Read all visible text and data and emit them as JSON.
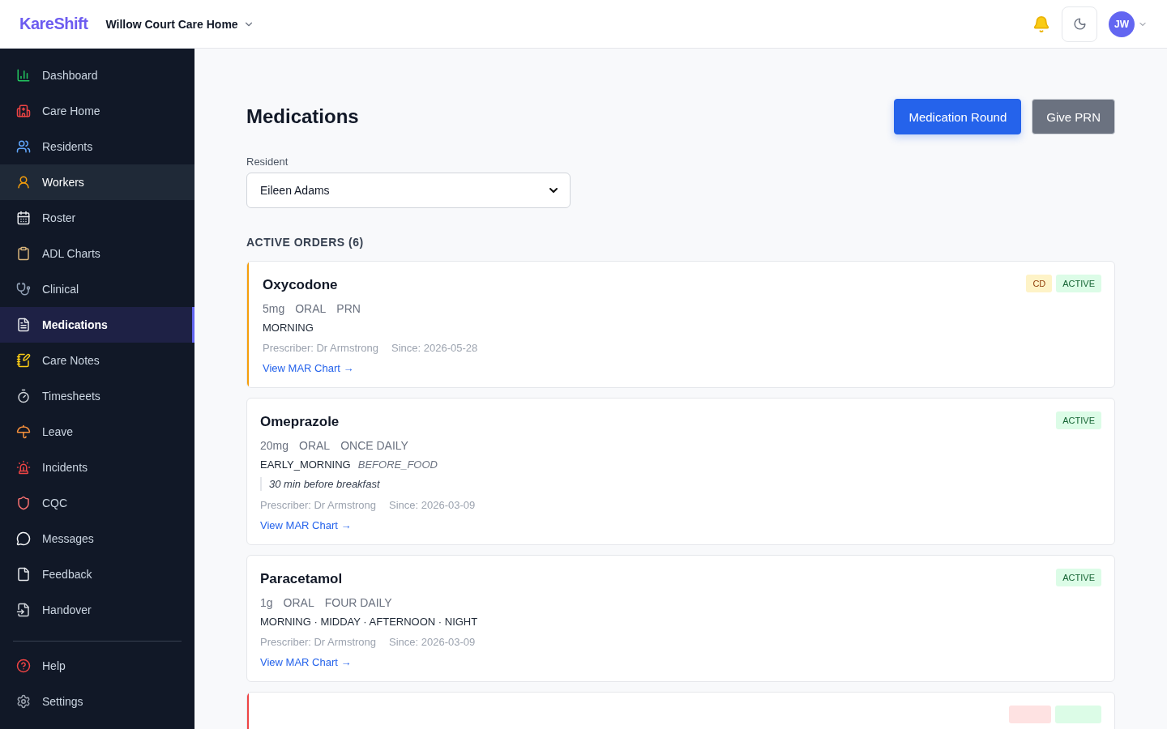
{
  "header": {
    "logo": "KareShift",
    "home": "Willow Court Care Home",
    "avatar": "JW"
  },
  "sidebar": {
    "items": [
      {
        "label": "Dashboard",
        "selected": false,
        "hovered": false
      },
      {
        "label": "Care Home",
        "selected": false,
        "hovered": false
      },
      {
        "label": "Residents",
        "selected": false,
        "hovered": false
      },
      {
        "label": "Workers",
        "selected": false,
        "hovered": true
      },
      {
        "label": "Roster",
        "selected": false,
        "hovered": false
      },
      {
        "label": "ADL Charts",
        "selected": false,
        "hovered": false
      },
      {
        "label": "Clinical",
        "selected": false,
        "hovered": false
      },
      {
        "label": "Medications",
        "selected": true,
        "hovered": false
      },
      {
        "label": "Care Notes",
        "selected": false,
        "hovered": false
      },
      {
        "label": "Timesheets",
        "selected": false,
        "hovered": false
      },
      {
        "label": "Leave",
        "selected": false,
        "hovered": false
      },
      {
        "label": "Incidents",
        "selected": false,
        "hovered": false
      },
      {
        "label": "CQC",
        "selected": false,
        "hovered": false
      },
      {
        "label": "Messages",
        "selected": false,
        "hovered": false
      },
      {
        "label": "Feedback",
        "selected": false,
        "hovered": false
      },
      {
        "label": "Handover",
        "selected": false,
        "hovered": false
      }
    ],
    "footer_items": [
      {
        "label": "Help"
      },
      {
        "label": "Settings"
      }
    ]
  },
  "page": {
    "title": "Medications",
    "buttons": [
      {
        "label": "Medication Round",
        "kind": "primary"
      },
      {
        "label": "Give PRN",
        "kind": "secondary"
      }
    ],
    "resident_label": "Resident",
    "resident_value": "Eileen Adams",
    "section_title": "ACTIVE ORDERS (6)"
  },
  "orders": [
    {
      "kind": "full",
      "name": "Oxycodone",
      "color": "#f59e0b",
      "badges": [
        {
          "label": "CD",
          "kind": "cd"
        },
        {
          "label": "ACTIVE",
          "kind": "status"
        }
      ],
      "dose": [
        "5mg",
        "ORAL",
        "PRN"
      ],
      "times": "MORNING",
      "prescriber": "Prescriber: Dr Armstrong",
      "since": "Since: 2026-05-28",
      "link": "View MAR Chart →"
    },
    {
      "kind": "full",
      "name": "Omeprazole",
      "badges": [
        {
          "label": "ACTIVE",
          "kind": "status"
        }
      ],
      "dose": [
        "20mg",
        "ORAL",
        "ONCE DAILY"
      ],
      "times": "EARLY_MORNING",
      "timing": "BEFORE_FOOD",
      "note": "30 min before breakfast",
      "prescriber": "Prescriber: Dr Armstrong",
      "since": "Since: 2026-03-09",
      "link": "View MAR Chart →"
    },
    {
      "kind": "full",
      "name": "Paracetamol",
      "badges": [
        {
          "label": "ACTIVE",
          "kind": "status"
        }
      ],
      "dose": [
        "1g",
        "ORAL",
        "FOUR DAILY"
      ],
      "times": "MORNING · MIDDAY · AFTERNOON · NIGHT",
      "prescriber": "Prescriber: Dr Armstrong",
      "since": "Since: 2026-03-09",
      "link": "View MAR Chart →"
    },
    {
      "kind": "cut",
      "color": "#ef4444",
      "badges": [
        {
          "kind": "critical"
        },
        {
          "kind": "status"
        }
      ]
    }
  ]
}
